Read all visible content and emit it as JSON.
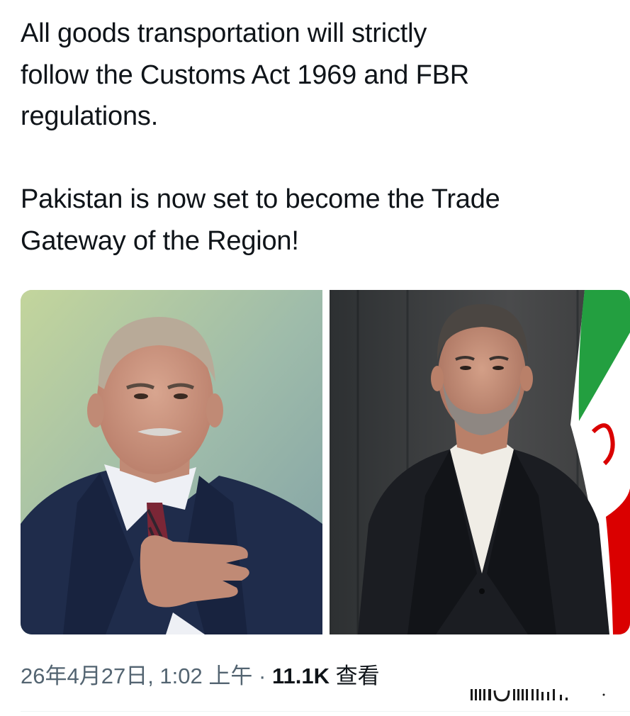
{
  "post": {
    "paragraph_1": "All goods transportation will strictly\nfollow the Customs Act 1969 and FBR\nregulations.",
    "paragraph_2": "Pakistan is now set to become the Trade\nGateway of the Region!"
  },
  "media": {
    "image_left": "man in navy suit with hand on chest",
    "image_right": "man in black suit in front of flag"
  },
  "meta": {
    "timestamp": "26年4月27日, 1:02 上午",
    "separator": " · ",
    "views_count": "11.1K",
    "views_label": " 查看"
  },
  "colors": {
    "text_primary": "#0f1419",
    "text_secondary": "#536471",
    "divider": "#eff3f4"
  }
}
